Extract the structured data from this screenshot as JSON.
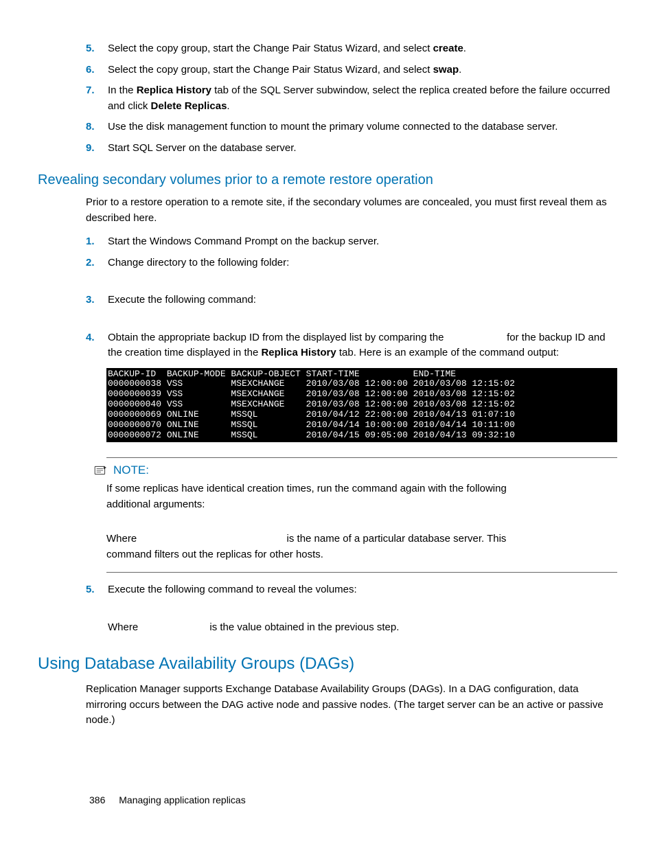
{
  "steps_top": [
    {
      "n": "5.",
      "pre": "Select the copy group, start the Change Pair Status Wizard, and select ",
      "bold": "create",
      "post": "."
    },
    {
      "n": "6.",
      "pre": "Select the copy group, start the Change Pair Status Wizard, and select ",
      "bold": "swap",
      "post": "."
    },
    {
      "n": "7.",
      "pre": "In the ",
      "bold": "Replica History",
      "mid": " tab of the SQL Server subwindow, select the replica created before the failure occurred and click ",
      "bold2": "Delete Replicas",
      "post": "."
    },
    {
      "n": "8.",
      "text": "Use the disk management function to mount the primary volume connected to the database server."
    },
    {
      "n": "9.",
      "text": "Start SQL Server on the database server."
    }
  ],
  "h3_1": "Revealing secondary volumes prior to a remote restore operation",
  "p_intro": "Prior to a restore operation to a remote site, if the secondary volumes are concealed, you must first reveal them as described here.",
  "steps_mid": [
    {
      "n": "1.",
      "text": "Start the Windows Command Prompt on the backup server."
    },
    {
      "n": "2.",
      "text": "Change directory to the following folder:"
    },
    {
      "n": "3.",
      "text": "Execute the following command:"
    },
    {
      "n": "4.",
      "pre": "Obtain the appropriate backup ID from the displayed list by comparing the ",
      "gap": "                    ",
      "mid": " for the backup ID and the creation time displayed in the ",
      "bold": "Replica History",
      "post": " tab. Here is an example of the command output:"
    }
  ],
  "cmd_output": "BACKUP-ID  BACKUP-MODE BACKUP-OBJECT START-TIME          END-TIME\n0000000038 VSS         MSEXCHANGE    2010/03/08 12:00:00 2010/03/08 12:15:02\n0000000039 VSS         MSEXCHANGE    2010/03/08 12:00:00 2010/03/08 12:15:02\n0000000040 VSS         MSEXCHANGE    2010/03/08 12:00:00 2010/03/08 12:15:02\n0000000069 ONLINE      MSSQL         2010/04/12 22:00:00 2010/04/13 01:07:10\n0000000070 ONLINE      MSSQL         2010/04/14 10:00:00 2010/04/14 10:11:00\n0000000072 ONLINE      MSSQL         2010/04/15 09:05:00 2010/04/13 09:32:10",
  "note_label": "NOTE:",
  "note_p1": "If some replicas have identical creation times, run the command again with the following additional arguments:",
  "note_p2_pre": "Where ",
  "note_p2_post": " is the name of a particular database server. This command filters out the replicas for other hosts.",
  "steps_bot": [
    {
      "n": "5.",
      "text": "Execute the following command to reveal the volumes:"
    }
  ],
  "p_where": "Where                         is the value obtained in the previous step.",
  "h2_1": "Using Database Availability Groups (DAGs)",
  "p_dag": "Replication Manager supports Exchange Database Availability Groups (DAGs). In a DAG configuration, data mirroring occurs between the DAG active node and passive nodes. (The target server can be an active or passive node.)",
  "footer_page": "386",
  "footer_title": "Managing application replicas"
}
